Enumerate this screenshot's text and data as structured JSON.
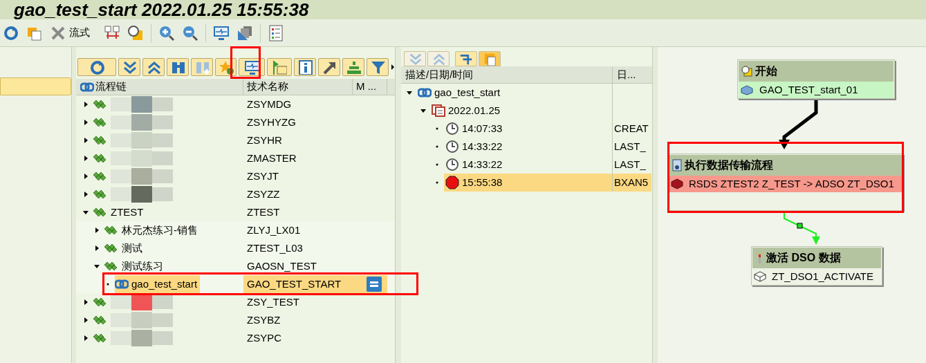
{
  "title": "gao_test_start 2022.01.25 15:55:38",
  "toolbar": {
    "label": "流式"
  },
  "chain_tree": {
    "columns": [
      "流程链",
      "技术名称",
      "M ..."
    ],
    "rows": [
      {
        "redacted": true,
        "color": "#8a9a9c",
        "tech_name": "ZSYMDG",
        "expanded": false,
        "selected": false,
        "active": false
      },
      {
        "redacted": true,
        "color": "#a3aca4",
        "tech_name": "ZSYHYZG",
        "expanded": false,
        "selected": false,
        "active": false
      },
      {
        "redacted": true,
        "color": "#c9d2c3",
        "tech_name": "ZSYHR",
        "expanded": false,
        "selected": false,
        "active": false
      },
      {
        "redacted": true,
        "color": "#d3dccd",
        "tech_name": "ZMASTER",
        "expanded": false,
        "selected": false,
        "active": false
      },
      {
        "redacted": true,
        "color": "#a9ae9f",
        "tech_name": "ZSYJT",
        "expanded": false,
        "selected": false,
        "active": false
      },
      {
        "redacted": true,
        "color": "#646a5e",
        "tech_name": "ZSYZZ",
        "expanded": false,
        "selected": false,
        "active": false
      },
      {
        "redacted": false,
        "name": "ZTEST",
        "tech_name": "ZTEST",
        "expanded": true,
        "selected": false,
        "active": false,
        "children": [
          {
            "redacted": false,
            "name": "林元杰练习-销售",
            "tech_name": "ZLYJ_LX01",
            "expanded": false,
            "selected": false,
            "active": false
          },
          {
            "redacted": false,
            "name": "测试",
            "tech_name": "ZTEST_L03",
            "expanded": false,
            "selected": false,
            "active": false
          },
          {
            "redacted": false,
            "name": "测试练习",
            "tech_name": "GAOSN_TEST",
            "expanded": true,
            "selected": false,
            "active": false,
            "children": [
              {
                "redacted": false,
                "leaf": true,
                "name": "gao_test_start",
                "tech_name": "GAO_TEST_START",
                "selected": true,
                "active": true
              }
            ]
          }
        ]
      },
      {
        "redacted": true,
        "color": "#f05555",
        "tech_name": "ZSY_TEST",
        "expanded": false,
        "selected": false,
        "active": false
      },
      {
        "redacted": true,
        "color": "#c8cec0",
        "tech_name": "ZSYBZ",
        "expanded": false,
        "selected": false,
        "active": false
      },
      {
        "redacted": true,
        "color": "#aab0a2",
        "tech_name": "ZSYPC",
        "expanded": false,
        "selected": false,
        "active": false
      }
    ]
  },
  "log_tree": {
    "columns": [
      "描述/日期/时间",
      "日..."
    ],
    "rows": [
      {
        "kind": "chain",
        "label": "gao_test_start",
        "expanded": true,
        "selected": false,
        "children": [
          {
            "kind": "date",
            "label": "2022.01.25",
            "expanded": true,
            "selected": false,
            "children": [
              {
                "kind": "time",
                "label": "14:07:33",
                "info": "CREAT",
                "selected": false
              },
              {
                "kind": "time",
                "label": "14:33:22",
                "info": "LAST_",
                "selected": false
              },
              {
                "kind": "time",
                "label": "14:33:22",
                "info": "LAST_",
                "selected": false
              },
              {
                "kind": "error",
                "label": "15:55:38",
                "info": "BXAN5",
                "selected": true
              }
            ]
          }
        ]
      }
    ]
  },
  "process": {
    "nodes": [
      {
        "kind": "start",
        "title": "开始",
        "item": "GAO_TEST_start_01",
        "color": "#c8f5c4"
      },
      {
        "kind": "transfer",
        "title": "执行数据传输流程",
        "item": "RSDS ZTEST2 Z_TEST -> ADSO ZT_DSO1",
        "color": "#f7988c"
      },
      {
        "kind": "activate",
        "title": "激活 DSO 数据",
        "item": "ZT_DSO1_ACTIVATE",
        "color": "#eef3e6"
      }
    ],
    "links": [
      {
        "kind": "always"
      },
      {
        "kind": "success"
      }
    ]
  }
}
